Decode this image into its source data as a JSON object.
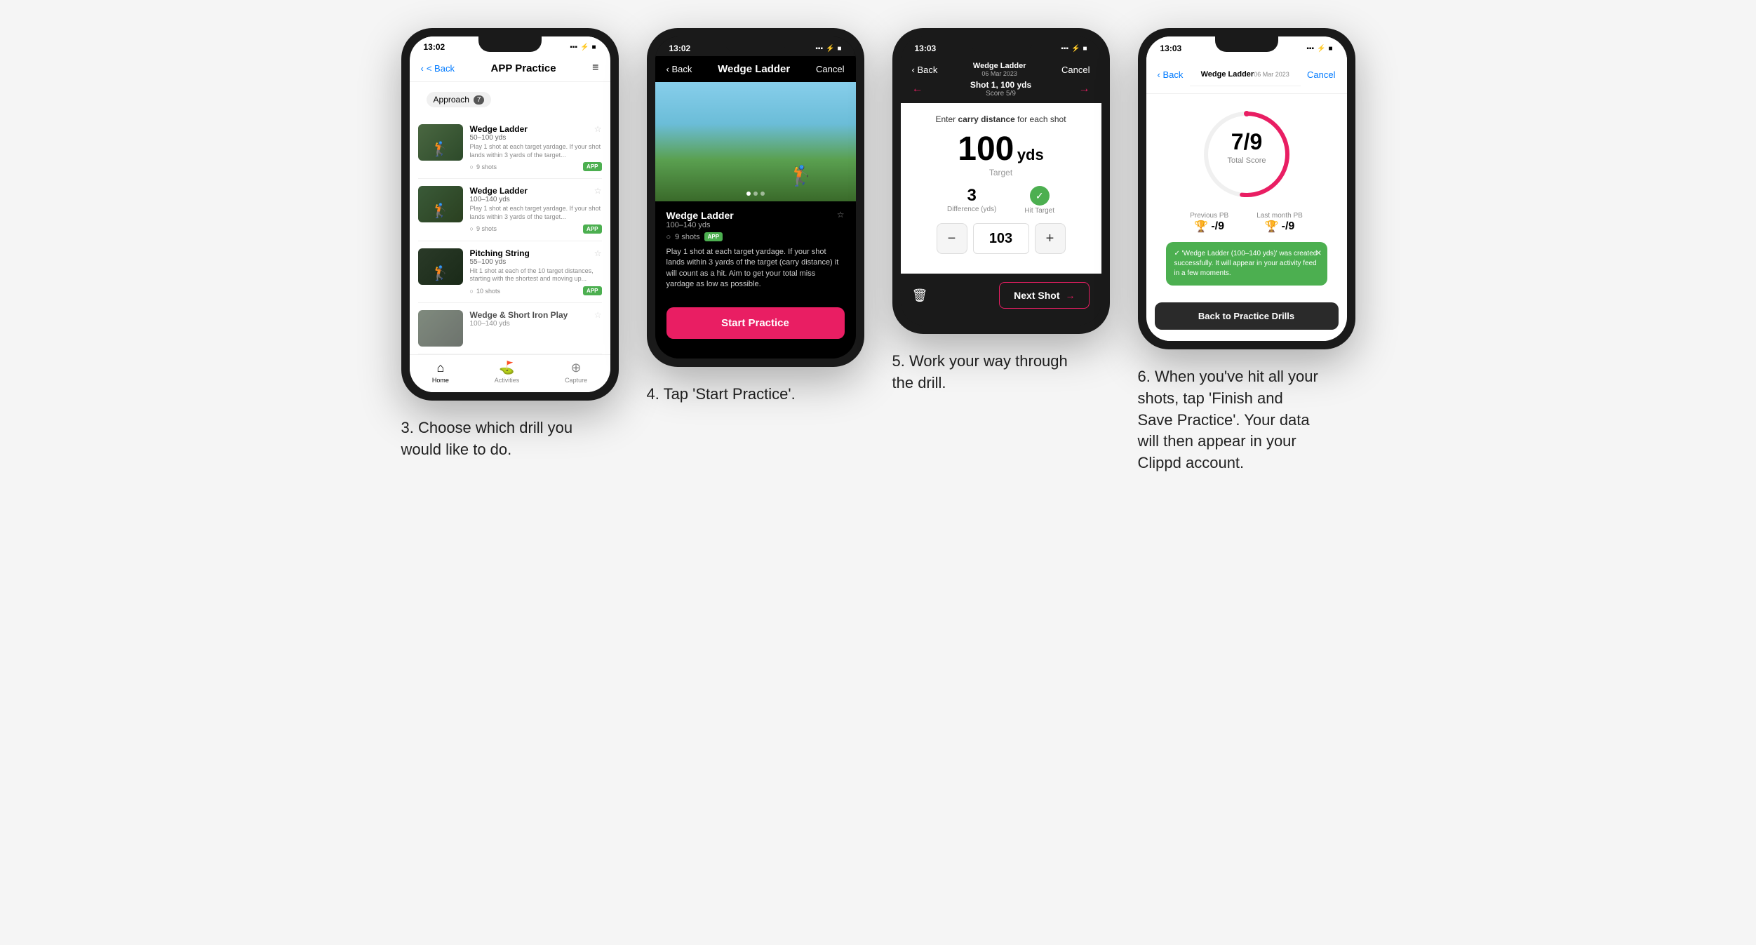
{
  "page": {
    "background": "#f5f5f5"
  },
  "phone1": {
    "status_time": "13:02",
    "nav_back": "< Back",
    "nav_title": "APP Practice",
    "category": "Approach",
    "category_count": "7",
    "drills": [
      {
        "name": "Wedge Ladder",
        "yds": "50–100 yds",
        "desc": "Play 1 shot at each target yardage. If your shot lands within 3 yards of the target...",
        "shots": "9 shots",
        "badge": "APP"
      },
      {
        "name": "Wedge Ladder",
        "yds": "100–140 yds",
        "desc": "Play 1 shot at each target yardage. If your shot lands within 3 yards of the target...",
        "shots": "9 shots",
        "badge": "APP"
      },
      {
        "name": "Pitching String",
        "yds": "55–100 yds",
        "desc": "Hit 1 shot at each of the 10 target distances, starting with the shortest and moving up...",
        "shots": "10 shots",
        "badge": "APP"
      },
      {
        "name": "Wedge & Short Iron Play",
        "yds": "100–140 yds",
        "desc": "",
        "shots": "",
        "badge": ""
      }
    ],
    "bottom_nav": [
      {
        "label": "Home",
        "icon": "⌂",
        "active": true
      },
      {
        "label": "Activities",
        "icon": "🏌",
        "active": false
      },
      {
        "label": "Capture",
        "icon": "+",
        "active": false
      }
    ],
    "caption": "3. Choose which drill you would like to do."
  },
  "phone2": {
    "status_time": "13:02",
    "nav_back": "< Back",
    "nav_title": "Wedge Ladder",
    "nav_cancel": "Cancel",
    "drill_name": "Wedge Ladder",
    "drill_yds": "100–140 yds",
    "drill_shots": "9 shots",
    "drill_badge": "APP",
    "drill_desc": "Play 1 shot at each target yardage. If your shot lands within 3 yards of the target (carry distance) it will count as a hit. Aim to get your total miss yardage as low as possible.",
    "start_btn": "Start Practice",
    "caption": "4. Tap 'Start Practice'."
  },
  "phone3": {
    "status_time": "13:03",
    "nav_back": "< Back",
    "nav_subtitle": "Wedge Ladder\n06 Mar 2023",
    "nav_cancel": "Cancel",
    "nav_title": "Wedge Ladder",
    "nav_date": "06 Mar 2023",
    "shot_number": "Shot 1, 100 yds",
    "shot_score": "Score 5/9",
    "carry_instruction": "Enter carry distance for each shot",
    "carry_bold": "carry distance",
    "target_yds": "100",
    "target_unit": "yds",
    "target_label": "Target",
    "difference_value": "3",
    "difference_label": "Difference (yds)",
    "hit_target_label": "Hit Target",
    "stepper_value": "103",
    "next_shot_btn": "Next Shot",
    "caption": "5. Work your way through the drill."
  },
  "phone4": {
    "status_time": "13:03",
    "nav_back": "< Back",
    "nav_title": "Wedge Ladder",
    "nav_date": "06 Mar 2023",
    "nav_cancel": "Cancel",
    "score_value": "7",
    "score_total": "9",
    "score_label": "Total Score",
    "prev_pb_label": "Previous PB",
    "prev_pb_value": "-/9",
    "last_month_pb_label": "Last month PB",
    "last_month_pb_value": "-/9",
    "toast_text": "'Wedge Ladder (100–140 yds)' was created successfully. It will appear in your activity feed in a few moments.",
    "back_btn": "Back to Practice Drills",
    "caption": "6. When you've hit all your shots, tap 'Finish and Save Practice'. Your data will then appear in your Clippd account."
  },
  "icons": {
    "back_arrow": "‹",
    "forward_arrow": "›",
    "star": "☆",
    "clock": "○",
    "signal": "▪▪▪",
    "wifi": "WiFi",
    "battery": "▮",
    "menu": "≡",
    "trash": "🗑",
    "check": "✓",
    "close": "×",
    "minus": "−",
    "plus": "+"
  }
}
